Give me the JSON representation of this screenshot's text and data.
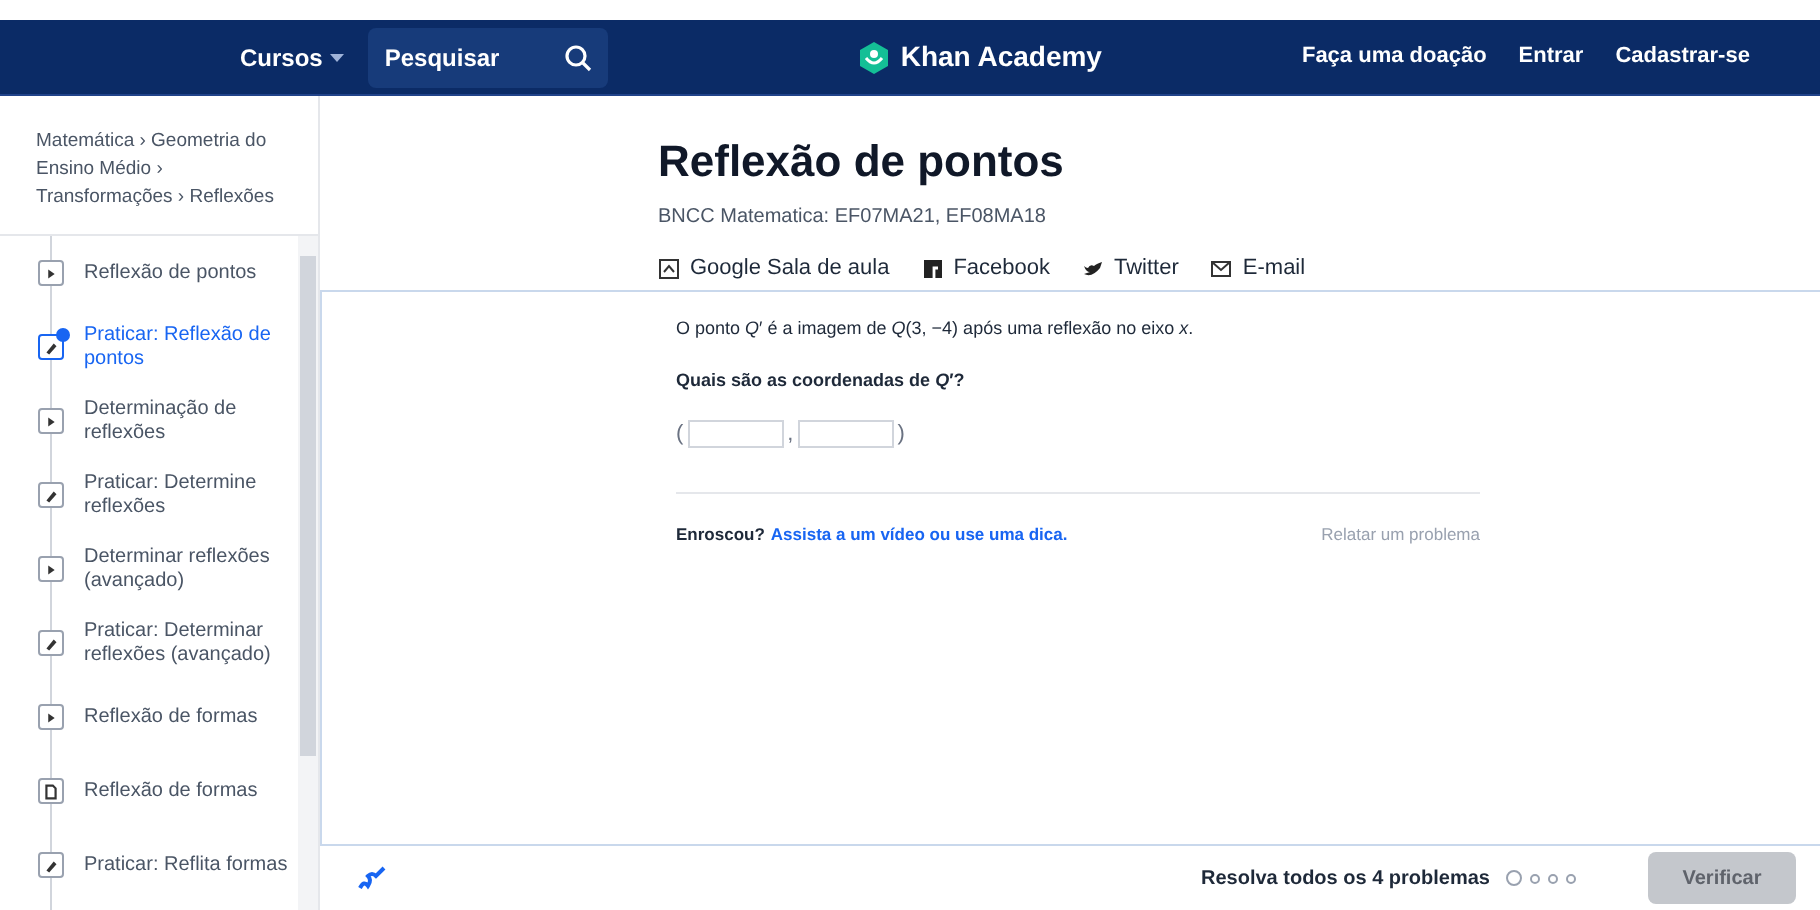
{
  "nav": {
    "courses": "Cursos",
    "search_placeholder": "Pesquisar",
    "logo": "Khan Academy",
    "links": [
      "Faça uma doação",
      "Entrar",
      "Cadastrar-se"
    ]
  },
  "breadcrumb": "Matemática › Geometria do Ensino Médio › Transformações › Reflexões",
  "sidebar": {
    "items": [
      {
        "kind": "video",
        "label": "Reflexão de pontos",
        "selected": false
      },
      {
        "kind": "exercise",
        "label": "Praticar: Reflexão de pontos",
        "selected": true
      },
      {
        "kind": "video",
        "label": "Determinação de reflexões",
        "selected": false
      },
      {
        "kind": "exercise",
        "label": "Praticar: Determine reflexões",
        "selected": false
      },
      {
        "kind": "video",
        "label": "Determinar reflexões (avançado)",
        "selected": false
      },
      {
        "kind": "exercise",
        "label": "Praticar: Determinar reflexões (avançado)",
        "selected": false
      },
      {
        "kind": "video",
        "label": "Reflexão de formas",
        "selected": false
      },
      {
        "kind": "article",
        "label": "Reflexão de formas",
        "selected": false
      },
      {
        "kind": "exercise",
        "label": "Praticar: Reflita formas",
        "selected": false
      }
    ]
  },
  "header": {
    "title": "Reflexão de pontos",
    "standards": "BNCC Matematica: EF07MA21, EF08MA18",
    "share": [
      {
        "kind": "classroom",
        "label": "Google Sala de aula"
      },
      {
        "kind": "facebook",
        "label": "Facebook"
      },
      {
        "kind": "twitter",
        "label": "Twitter"
      },
      {
        "kind": "email",
        "label": "E-mail"
      }
    ]
  },
  "exercise": {
    "statement": "O ponto *Q*′ é a imagem de *Q*(3, −4) após uma reflexão no eixo *x*.",
    "question": "Quais são as coordenadas de *Q*′?",
    "open_paren": "(",
    "comma": ",",
    "close_paren": ")",
    "stuck": "Enroscou?",
    "hint_link": "Assista a um vídeo ou use uma dica.",
    "report": "Relatar um problema"
  },
  "footer": {
    "progress_text": "Resolva todos os 4 problemas",
    "dots": [
      {
        "selected": true
      },
      {
        "selected": false
      },
      {
        "selected": false
      },
      {
        "selected": false
      }
    ],
    "check_button": "Verificar",
    "check_disabled": true
  }
}
